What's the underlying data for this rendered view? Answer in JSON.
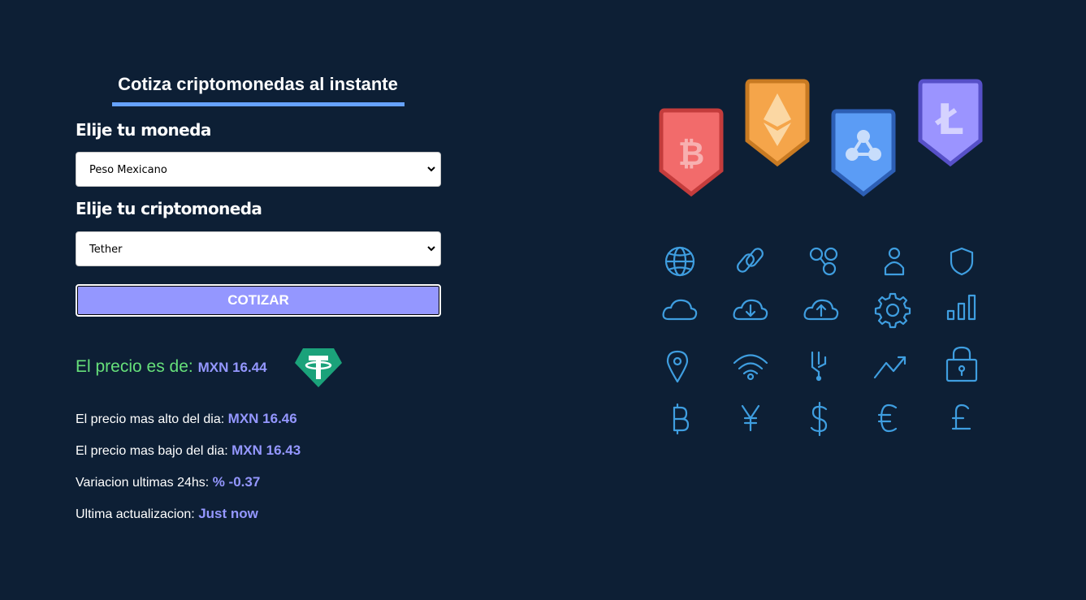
{
  "heading": "Cotiza criptomonedas al instante",
  "form": {
    "currency_label": "Elije tu moneda",
    "currency_value": "Peso Mexicano",
    "crypto_label": "Elije tu criptomoneda",
    "crypto_value": "Tether",
    "submit_label": "COTIZAR"
  },
  "result": {
    "price_label": "El precio es de:",
    "price_value": "MXN 16.44",
    "high_label": "El precio mas alto del dia:",
    "high_value": "MXN 16.46",
    "low_label": "El precio mas bajo del dia:",
    "low_value": "MXN 16.43",
    "change_label": "Variacion ultimas 24hs:",
    "change_value": "% -0.37",
    "updated_label": "Ultima actualizacion:",
    "updated_value": "Just now"
  },
  "icons": {
    "coin_logo": "tether-logo-icon",
    "badges": [
      "bitcoin-badge-icon",
      "ethereum-badge-icon",
      "ripple-badge-icon",
      "litecoin-badge-icon"
    ],
    "grid": [
      "globe-icon",
      "link-icon",
      "network-icon",
      "user-icon",
      "shield-icon",
      "cloud-icon",
      "cloud-download-icon",
      "cloud-upload-icon",
      "gear-icon",
      "bar-chart-icon",
      "location-pin-icon",
      "wifi-icon",
      "circuit-icon",
      "trend-up-icon",
      "padlock-icon",
      "bitcoin-symbol-icon",
      "yen-symbol-icon",
      "dollar-symbol-icon",
      "euro-symbol-icon",
      "pound-symbol-icon"
    ]
  },
  "colors": {
    "background": "#0d1f35",
    "accent": "#9497ff",
    "underline": "#66a2fe",
    "price_label": "#66e07a",
    "icon_stroke": "#3f9ee0"
  }
}
